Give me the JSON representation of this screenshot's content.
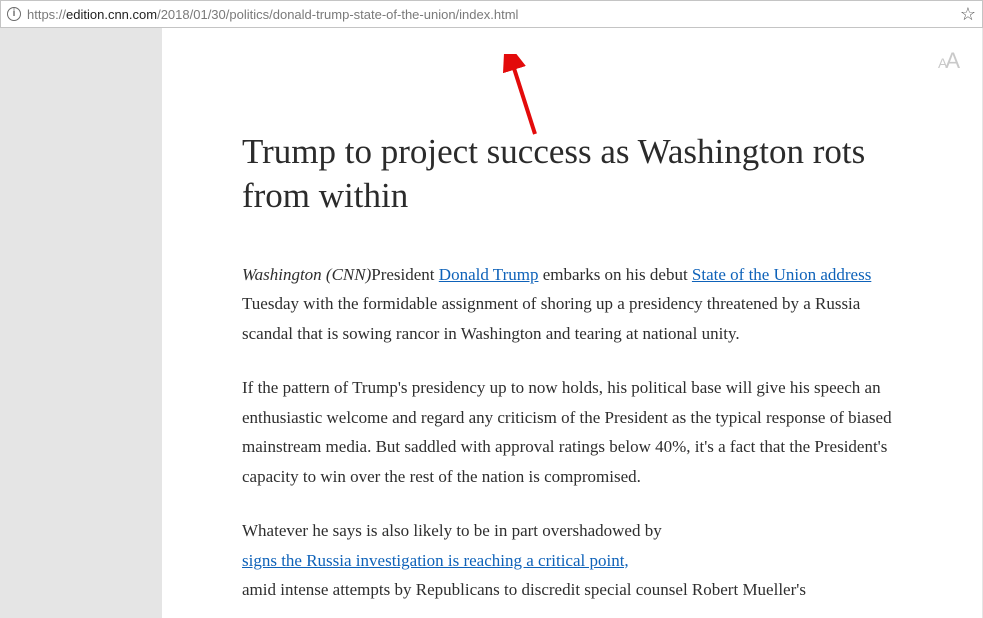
{
  "address_bar": {
    "scheme": "https://",
    "host": "edition.cnn.com",
    "path": "/2018/01/30/politics/donald-trump-state-of-the-union/index.html"
  },
  "reader": {
    "font_toggle_small": "A",
    "font_toggle_big": "A"
  },
  "article": {
    "headline": "Trump to project success as Washington rots from within",
    "byline_location": "Washington (CNN)",
    "p1_a": "President ",
    "link_trump": "Donald Trump",
    "p1_b": " embarks on his debut ",
    "link_sotu": "State of the Union address",
    "p1_c": " Tuesday with the formidable assignment of shoring up a presidency threatened by a Russia scandal that is sowing rancor in Washington and tearing at national unity.",
    "p2": "If the pattern of Trump's presidency up to now holds, his political base will give his speech an enthusiastic welcome and regard any criticism of the President as the typical response of biased mainstream media. But saddled with approval ratings below 40%, it's a fact that the President's capacity to win over the rest of the nation is compromised.",
    "p3_a": "Whatever he says is also likely to be in part overshadowed by ",
    "link_russia": "signs the Russia investigation is reaching a critical point,",
    "p3_b": " amid intense attempts by Republicans to discredit special counsel Robert Mueller's"
  }
}
